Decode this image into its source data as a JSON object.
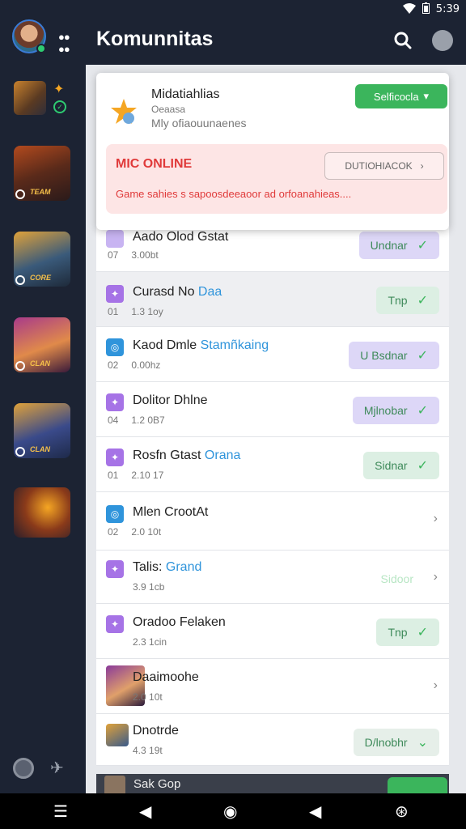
{
  "status": {
    "time": "5:39"
  },
  "header": {
    "title": "Komunnitas"
  },
  "featured": {
    "title": "Midatiahlias",
    "sub1": "Oeaasa",
    "sub2": "Mly ofiaouunaenes",
    "button_label": "Selficocla",
    "alert": {
      "title": "MIC ONLINE",
      "button_label": "DUTIOHIACOK",
      "message": "Game sahies s sapoosdeeaoor ad orfoanahieas...."
    }
  },
  "rows": [
    {
      "name": "Aado Olod Gstat",
      "code": "07",
      "meta": "3.00bt",
      "pill": "Undnar"
    },
    {
      "name": "Curasd No ",
      "name_hl": "Daa",
      "code": "01",
      "meta": "1.3 1oy",
      "pill": "Tnp"
    },
    {
      "name": "Kaod Dmle ",
      "name_hl": "Stamñkaing",
      "code": "02",
      "meta": "0.00hz",
      "pill": "U Bsdnar"
    },
    {
      "name": "Dolitor Dhlne",
      "code": "04",
      "meta": "1.2 0B7",
      "pill": "Mjlnobar"
    },
    {
      "name": "Rosfn Gtast ",
      "name_hl": "Orana",
      "code": "01",
      "meta": "2.10 17",
      "pill": "Sidnar"
    },
    {
      "name": "Mlen CrootAt",
      "code": "02",
      "meta": "2.0 10t"
    },
    {
      "name": "Talis: ",
      "name_hl": "Grand",
      "meta": "3.9 1cb",
      "pill": "Sidoor"
    },
    {
      "name": "Oradoo Felaken",
      "meta": "2.3 1cin",
      "pill": "Tnp"
    },
    {
      "name": "Daaimoohe",
      "meta": "2.0 10t"
    },
    {
      "name": "Dnotrde",
      "meta": "4.3 19t",
      "pill": "D/lnobhr"
    }
  ],
  "bottom_card": {
    "label": "Sak Gop"
  }
}
